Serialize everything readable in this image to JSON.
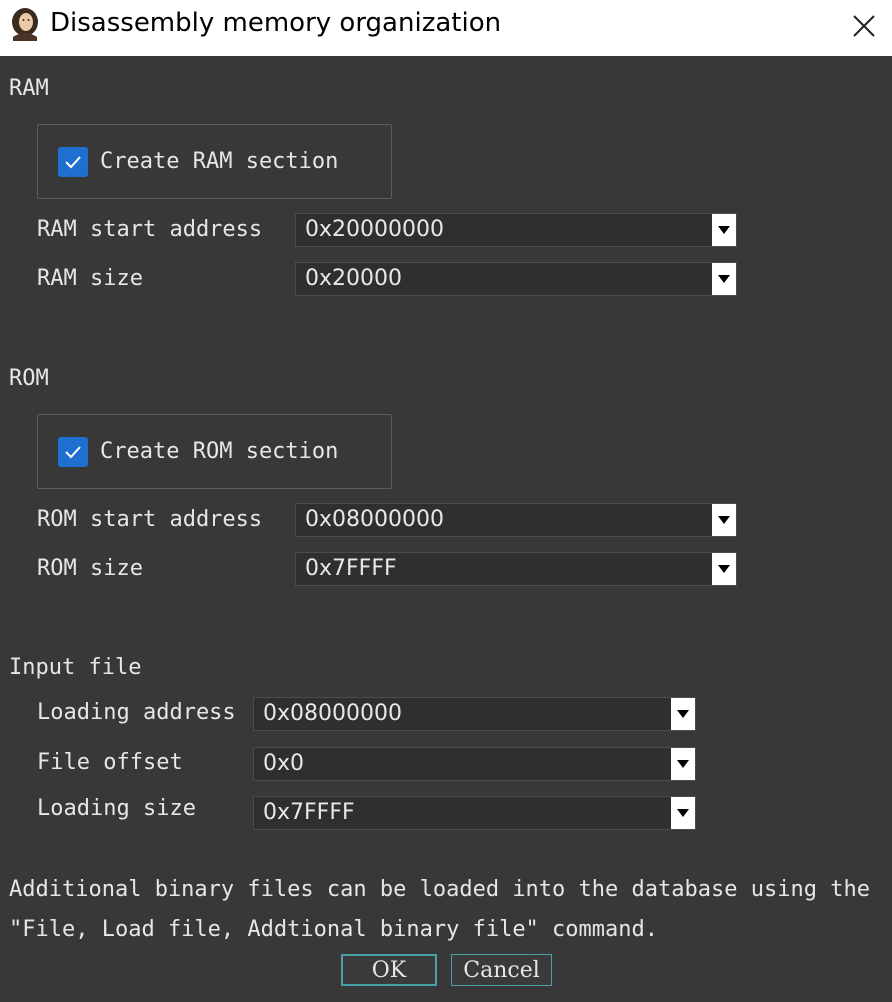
{
  "window": {
    "title": "Disassembly memory organization",
    "app_icon": "portrait-icon",
    "close_icon": "close-icon"
  },
  "ram": {
    "group_label": "RAM",
    "create_label": "Create RAM section",
    "create_checked": true,
    "start_label": "RAM start address",
    "start_value": "0x20000000",
    "size_label": "RAM size",
    "size_value": "0x20000"
  },
  "rom": {
    "group_label": "ROM",
    "create_label": "Create ROM section",
    "create_checked": true,
    "start_label": "ROM start address",
    "start_value": "0x08000000",
    "size_label": "ROM size",
    "size_value": "0x7FFFF"
  },
  "input_file": {
    "group_label": "Input file",
    "loading_address_label": "Loading address",
    "loading_address_value": "0x08000000",
    "file_offset_label": "File offset",
    "file_offset_value": "0x0",
    "loading_size_label": "Loading size",
    "loading_size_value": "0x7FFFF"
  },
  "info": {
    "line1": "Additional binary files can be loaded into the database using the",
    "line2": "\"File, Load file, Addtional binary file\" command."
  },
  "buttons": {
    "ok": "OK",
    "cancel": "Cancel"
  },
  "colors": {
    "background": "#383838",
    "checkbox": "#1e6fcf",
    "button_border": "#4aa0a8"
  }
}
